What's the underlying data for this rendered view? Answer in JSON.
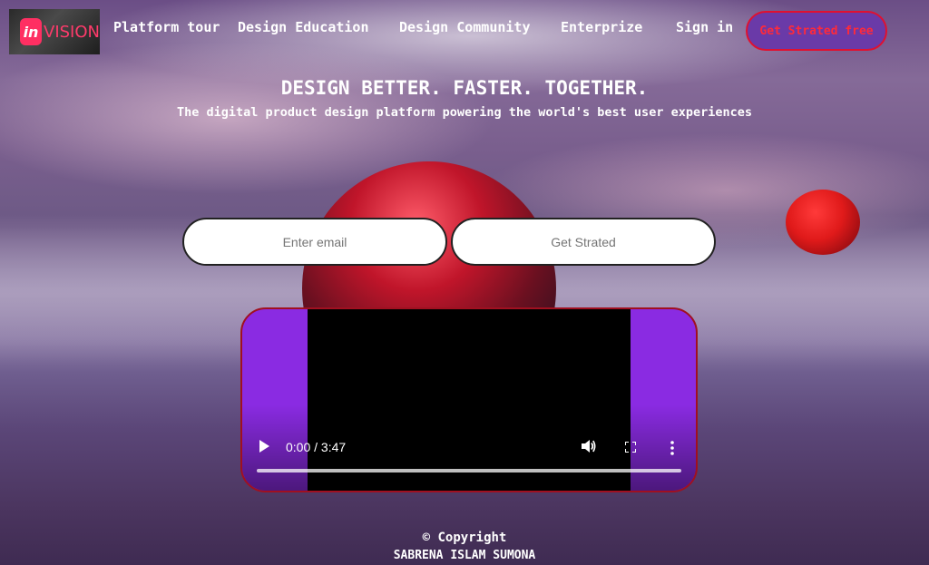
{
  "nav": {
    "logo_badge": "in",
    "logo_word": "VISION",
    "items": [
      {
        "label": "Platform tour"
      },
      {
        "label": "Design Education"
      },
      {
        "label": "Design Community"
      },
      {
        "label": "Enterprize"
      },
      {
        "label": "Sign in"
      }
    ],
    "cta_label": "Get Strated free"
  },
  "hero": {
    "title": "DESIGN BETTER. FASTER. TOGETHER.",
    "subtitle": "The digital product design platform powering the world's best user experiences"
  },
  "form": {
    "email_placeholder": "Enter email",
    "submit_label": "Get Strated"
  },
  "video": {
    "time": "0:00 / 3:47",
    "icons": [
      "play-icon",
      "volume-icon",
      "fullscreen-icon",
      "more-options-icon"
    ]
  },
  "footer": {
    "copyright": "© Copyright",
    "author": "SABRENA ISLAM SUMONA"
  },
  "colors": {
    "accent": "#ff2f62",
    "cta_bg": "#6a3aa8",
    "cta_border": "#e01030",
    "video_bg": "#8a2be2"
  }
}
